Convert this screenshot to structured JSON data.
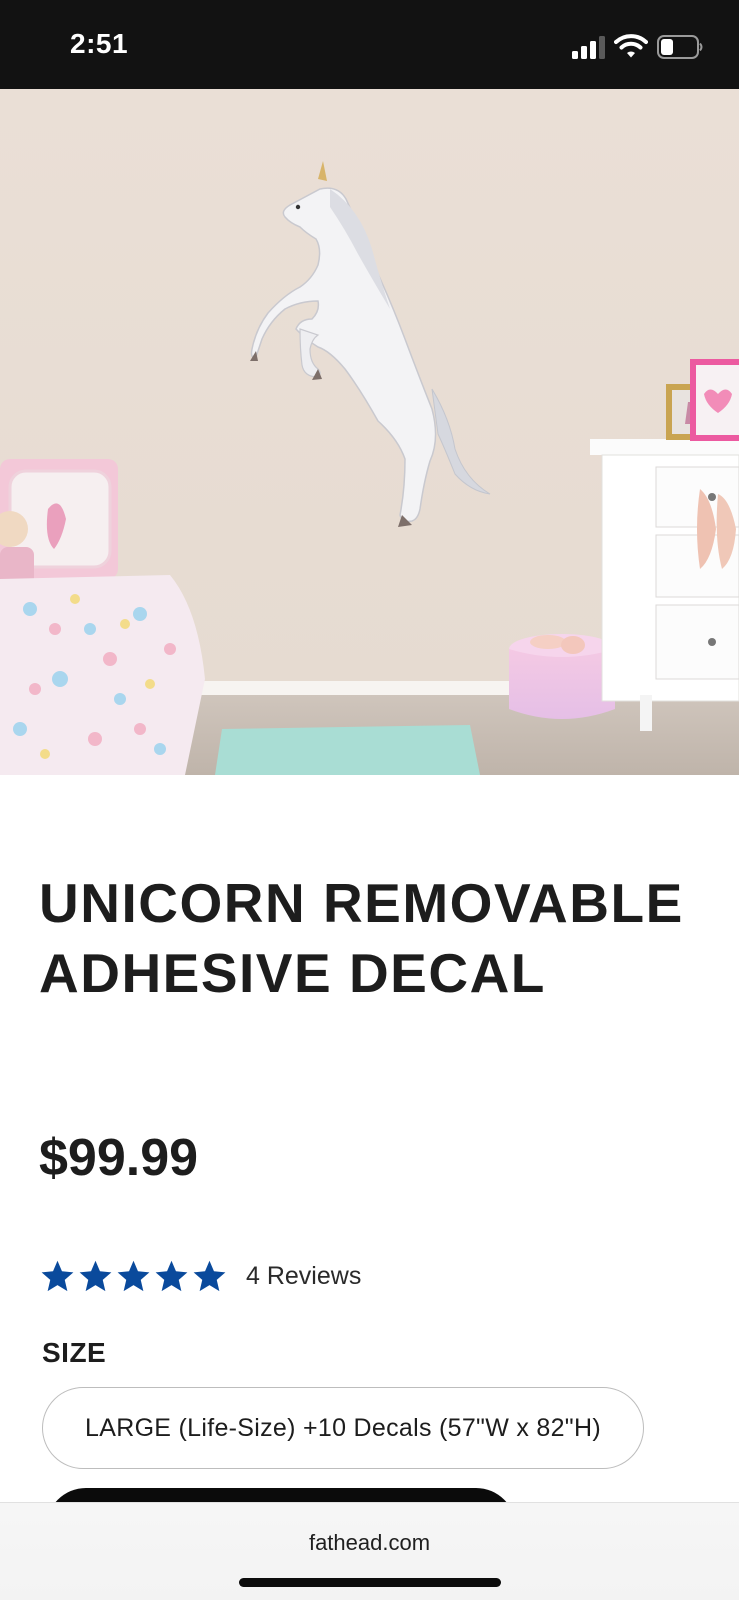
{
  "status_bar": {
    "time": "2:51"
  },
  "product": {
    "image_alt": "Unicorn decal on a bedroom wall",
    "title": "UNICORN REMOVABLE ADHESIVE DECAL",
    "price": "$99.99",
    "rating": 5,
    "rating_max": 5,
    "review_count_label": "4 Reviews",
    "size_label": "SIZE",
    "selected_size": "LARGE (Life-Size) +10 Decals (57\"W x 82\"H)"
  },
  "browser": {
    "url": "fathead.com"
  },
  "colors": {
    "star": "#0a4a9c",
    "status_bar_bg": "#121212",
    "cart_button_bg": "#0b0b0b"
  }
}
